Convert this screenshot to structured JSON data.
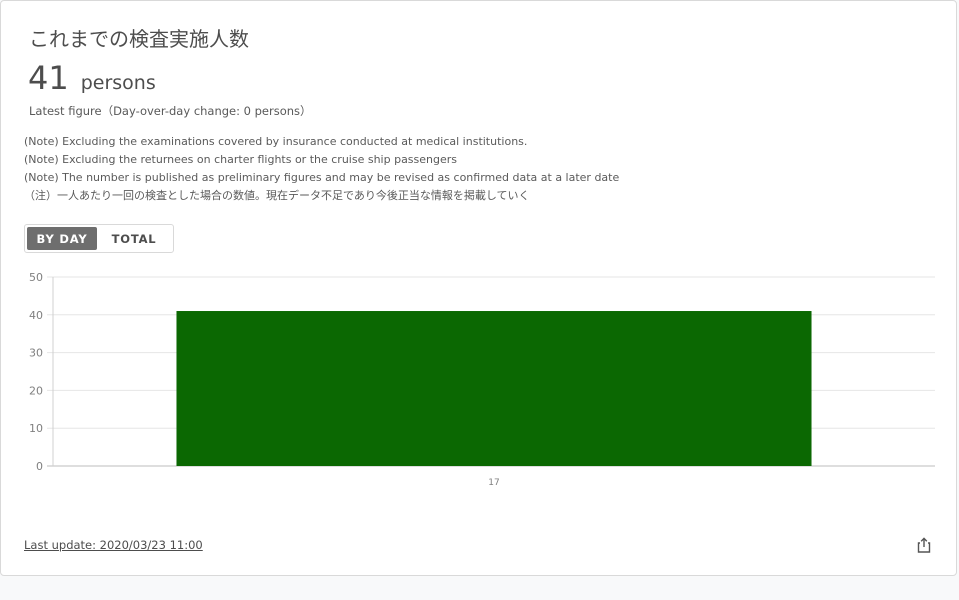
{
  "card": {
    "title": "これまでの検査実施人数",
    "figure": {
      "value": "41",
      "unit": "persons"
    },
    "latest": "Latest figure（Day-over-day change: 0 persons）",
    "notes": [
      "(Note) Excluding the examinations covered by insurance conducted at medical institutions.",
      "(Note) Excluding the returnees on charter flights or the cruise ship passengers",
      "(Note) The number is published as preliminary figures and may be revised as confirmed data at a later date",
      "（注）一人あたり一回の検査とした場合の数値。現在データ不足であり今後正当な情報を掲載していく"
    ],
    "toggle": {
      "by_day": "BY DAY",
      "total": "TOTAL",
      "selected": "BY DAY"
    },
    "footer": {
      "last_update": "Last update: 2020/03/23 11:00"
    }
  },
  "chart_data": {
    "type": "bar",
    "categories": [
      "17"
    ],
    "values": [
      41
    ],
    "ylim": [
      0,
      50
    ],
    "yticks": [
      "0",
      "10",
      "20",
      "30",
      "40",
      "50"
    ],
    "grid": true,
    "bar_color": "#0b6802",
    "legend": "none"
  },
  "icons": {
    "share": "share-icon"
  }
}
